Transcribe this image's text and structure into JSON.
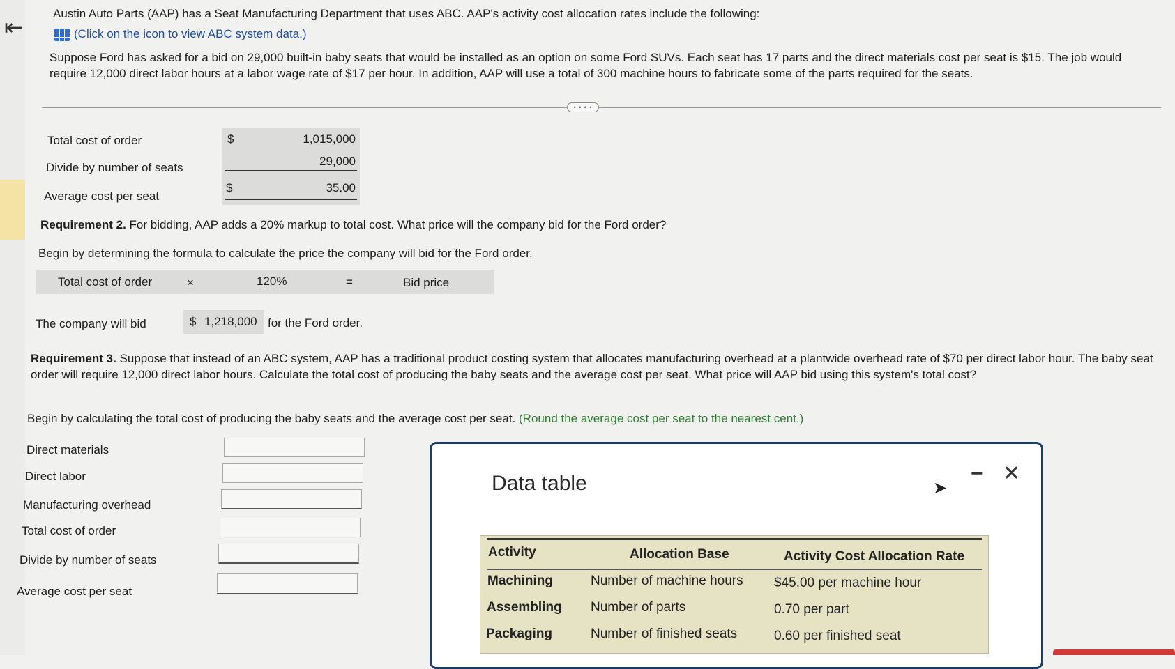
{
  "intro": {
    "text": "Austin Auto Parts (AAP) has a Seat Manufacturing Department that uses ABC. AAP's activity cost allocation rates include the following:",
    "link": "(Click on the icon to view ABC system data.)"
  },
  "scenario": "Suppose Ford has asked for a bid on 29,000 built-in baby seats that would be installed as an option on some Ford SUVs. Each seat has 17 parts and the direct materials cost per seat is $15. The job would require 12,000 direct labor hours at a labor wage rate of $17 per hour. In addition, AAP will use a total of 300 machine hours to fabricate some of the parts required for the seats.",
  "expander": "• • • •",
  "req1": {
    "rows": [
      {
        "label": "Total cost of order",
        "currency": "$",
        "value": "1,015,000"
      },
      {
        "label": "Divide by number of seats",
        "currency": "",
        "value": "29,000"
      },
      {
        "label": "Average cost per seat",
        "currency": "$",
        "value": "35.00"
      }
    ]
  },
  "req2": {
    "heading": "Requirement 2.",
    "text": "For bidding, AAP adds a 20% markup to total cost. What price will the company bid for the Ford order?",
    "instruction": "Begin by determining the formula to calculate the price the company will bid for the Ford order.",
    "formula": {
      "a": "Total cost of order",
      "op": "×",
      "b": "120%",
      "eq": "=",
      "result": "Bid price"
    },
    "answer_pre": "The company will bid",
    "answer_currency": "$",
    "answer_value": "1,218,000",
    "answer_post": "for the Ford order."
  },
  "req3": {
    "heading": "Requirement 3.",
    "text": "Suppose that instead of an ABC system, AAP has a traditional product costing system that allocates manufacturing overhead at a plantwide overhead rate of $70 per direct labor hour. The baby seat order will require 12,000 direct labor hours. Calculate the total cost of producing the baby seats and the average cost per seat. What price will AAP bid using this system's total cost?",
    "instruction": "Begin by calculating the total cost of producing the baby seats and the average cost per seat.",
    "hint": "(Round the average cost per seat to the nearest cent.)",
    "rows": [
      "Direct materials",
      "Direct labor",
      "Manufacturing overhead",
      "Total cost of order",
      "Divide by number of seats",
      "Average cost per seat"
    ]
  },
  "modal": {
    "title": "Data table",
    "minimize": "−",
    "close": "✕",
    "headers": [
      "Activity",
      "Allocation Base",
      "Activity Cost Allocation Rate"
    ],
    "rows": [
      [
        "Machining",
        "Number of machine hours",
        "$45.00 per machine hour"
      ],
      [
        "Assembling",
        "Number of parts",
        "0.70 per part"
      ],
      [
        "Packaging",
        "Number of finished seats",
        "0.60 per finished seat"
      ]
    ]
  }
}
